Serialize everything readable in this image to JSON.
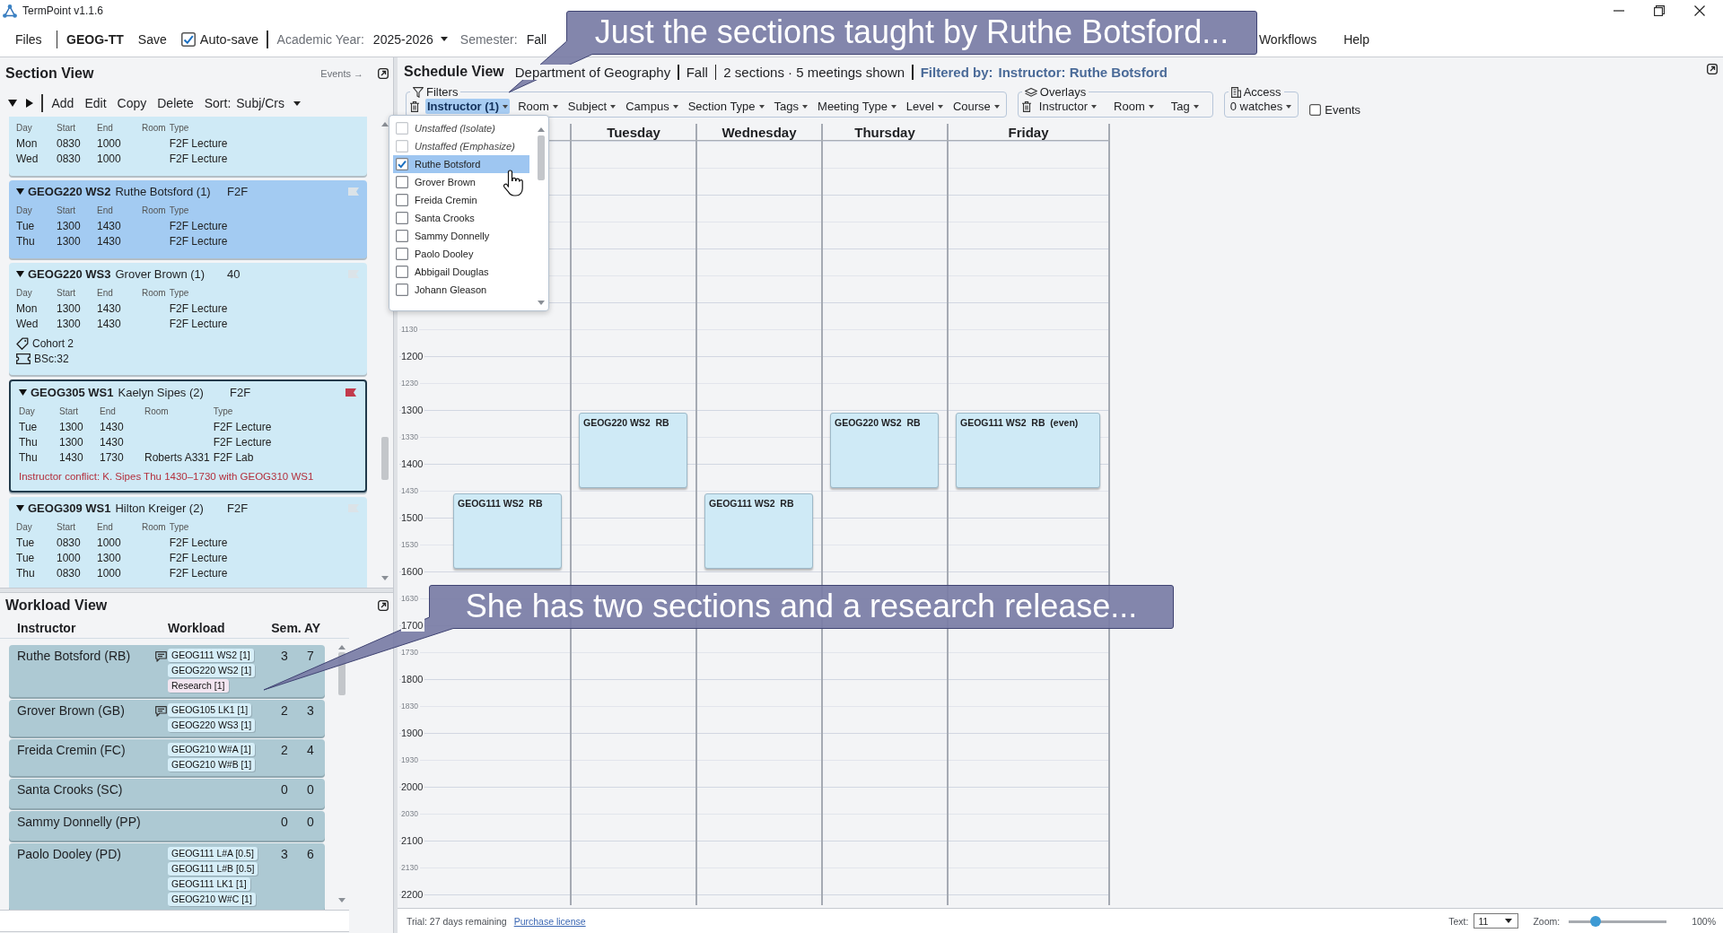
{
  "window": {
    "title": "TermPoint v1.1.6"
  },
  "menu_bar": {
    "files": "Files",
    "project": "GEOG-TT",
    "save": "Save",
    "autosave": {
      "label": "Auto-save",
      "checked": true
    },
    "academic_year": {
      "label": "Academic Year:",
      "value": "2025-2026"
    },
    "semester": {
      "label": "Semester:",
      "value": "Fall"
    },
    "menus": [
      "Workflows",
      "Help"
    ]
  },
  "callouts": [
    {
      "text": "Just the sections taught by Ruthe Botsford..."
    },
    {
      "text": "She has two sections and a research release..."
    }
  ],
  "section_view": {
    "title": "Section View",
    "events_link": "Events →",
    "toolbar": {
      "actions": [
        "Add",
        "Edit",
        "Copy",
        "Delete"
      ],
      "sort_label": "Sort:",
      "sort_value": "Subj/Crs"
    },
    "sections": [
      {
        "selected": false,
        "outlined": false,
        "columns": [
          "Day",
          "Start",
          "End",
          "Room",
          "Type"
        ],
        "meetings": [
          {
            "day": "Mon",
            "start": "0830",
            "end": "1000",
            "type": "F2F Lecture"
          },
          {
            "day": "Wed",
            "start": "0830",
            "end": "1000",
            "type": "F2F Lecture"
          }
        ]
      },
      {
        "expanded": true,
        "code": "GEOG220 WS2",
        "instructor": "Ruthe Botsford (1)",
        "aside": "F2F",
        "flagged": false,
        "selected": true,
        "outlined": false,
        "columns": [
          "Day",
          "Start",
          "End",
          "Room",
          "Type"
        ],
        "meetings": [
          {
            "day": "Tue",
            "start": "1300",
            "end": "1430",
            "type": "F2F Lecture"
          },
          {
            "day": "Thu",
            "start": "1300",
            "end": "1430",
            "type": "F2F Lecture"
          }
        ]
      },
      {
        "expanded": true,
        "code": "GEOG220 WS3",
        "instructor": "Grover Brown (1)",
        "aside": "40",
        "flagged": false,
        "selected": false,
        "outlined": false,
        "columns": [
          "Day",
          "Start",
          "End",
          "Room",
          "Type"
        ],
        "meetings": [
          {
            "day": "Mon",
            "start": "1300",
            "end": "1430",
            "type": "F2F Lecture"
          },
          {
            "day": "Wed",
            "start": "1300",
            "end": "1430",
            "type": "F2F Lecture"
          }
        ],
        "tags": [
          {
            "kind": "tag",
            "label": "Cohort 2"
          },
          {
            "kind": "seats",
            "label": "BSc:32"
          }
        ]
      },
      {
        "expanded": true,
        "code": "GEOG305 WS1",
        "instructor": "Kaelyn Sipes (2)",
        "aside": "F2F",
        "flagged": true,
        "selected": false,
        "outlined": true,
        "columns": [
          "Day",
          "Start",
          "End",
          "Room",
          "Type"
        ],
        "meetings": [
          {
            "day": "Tue",
            "start": "1300",
            "end": "1430",
            "type": "F2F Lecture"
          },
          {
            "day": "Thu",
            "start": "1300",
            "end": "1430",
            "type": "F2F Lecture"
          },
          {
            "day": "Thu",
            "start": "1430",
            "end": "1730",
            "room": "Roberts A331",
            "type": "F2F Lab"
          }
        ],
        "conflict": "Instructor conflict: K. Sipes Thu 1430–1730 with GEOG310 WS1"
      },
      {
        "expanded": true,
        "code": "GEOG309 WS1",
        "instructor": "Hilton Kreiger (2)",
        "aside": "F2F",
        "flagged": false,
        "selected": false,
        "outlined": false,
        "columns": [
          "Day",
          "Start",
          "End",
          "Room",
          "Type"
        ],
        "meetings": [
          {
            "day": "Tue",
            "start": "0830",
            "end": "1000",
            "type": "F2F Lecture"
          },
          {
            "day": "Tue",
            "start": "1000",
            "end": "1300",
            "type": "F2F Lecture"
          },
          {
            "day": "Thu",
            "start": "0830",
            "end": "1000",
            "type": "F2F Lecture"
          }
        ]
      }
    ]
  },
  "workload_view": {
    "title": "Workload View",
    "columns": [
      "Instructor",
      "Workload",
      "Sem.",
      "AY"
    ],
    "rows": [
      {
        "name": "Ruthe Botsford (RB)",
        "note": true,
        "items": [
          {
            "label": "GEOG111 WS2 [1]",
            "kind": "section"
          },
          {
            "label": "GEOG220 WS2 [1]",
            "kind": "section"
          },
          {
            "label": "Research [1]",
            "kind": "release"
          }
        ],
        "sem": "3",
        "ay": "7"
      },
      {
        "name": "Grover Brown (GB)",
        "note": true,
        "items": [
          {
            "label": "GEOG105 LK1 [1]",
            "kind": "section"
          },
          {
            "label": "GEOG220 WS3 [1]",
            "kind": "section"
          }
        ],
        "sem": "2",
        "ay": "3"
      },
      {
        "name": "Freida Cremin (FC)",
        "note": false,
        "items": [
          {
            "label": "GEOG210 W#A [1]",
            "kind": "section"
          },
          {
            "label": "GEOG210 W#B [1]",
            "kind": "section"
          }
        ],
        "sem": "2",
        "ay": "4"
      },
      {
        "name": "Santa Crooks (SC)",
        "note": false,
        "sem": "0",
        "ay": "0"
      },
      {
        "name": "Sammy Donnelly (PP)",
        "note": false,
        "sem": "0",
        "ay": "0"
      },
      {
        "name": "Paolo Dooley (PD)",
        "note": false,
        "items": [
          {
            "label": "GEOG111 L#A [0.5]",
            "kind": "section"
          },
          {
            "label": "GEOG111 L#B [0.5]",
            "kind": "section"
          },
          {
            "label": "GEOG111 LK1 [1]",
            "kind": "section"
          },
          {
            "label": "GEOG210 W#C [1]",
            "kind": "section"
          }
        ],
        "sem": "3",
        "ay": "6"
      }
    ]
  },
  "schedule_view": {
    "title": "Schedule View",
    "department": "Department of Geography",
    "semester": "Fall",
    "summary": "2 sections · 5 meetings shown",
    "filter_label": "Filtered by:",
    "filter_value": "Instructor: Ruthe Botsford",
    "filters": {
      "legend": "Filters",
      "items": [
        {
          "label": "Instructor (1)",
          "selected": true
        },
        {
          "label": "Room",
          "selected": false
        },
        {
          "label": "Subject",
          "selected": false
        },
        {
          "label": "Campus",
          "selected": false
        },
        {
          "label": "Section Type",
          "selected": false
        },
        {
          "label": "Tags",
          "selected": false
        },
        {
          "label": "Meeting Type",
          "selected": false
        },
        {
          "label": "Level",
          "selected": false
        },
        {
          "label": "Course",
          "selected": false
        }
      ]
    },
    "instructor_menu": {
      "options": [
        {
          "label": "Unstaffed (Isolate)",
          "kind": "special",
          "checked": false,
          "selected": false
        },
        {
          "label": "Unstaffed (Emphasize)",
          "kind": "special",
          "checked": false,
          "selected": false
        },
        {
          "label": "Ruthe Botsford",
          "kind": "person",
          "checked": true,
          "selected": true
        },
        {
          "label": "Grover Brown",
          "kind": "person",
          "checked": false,
          "selected": false
        },
        {
          "label": "Freida Cremin",
          "kind": "person",
          "checked": false,
          "selected": false
        },
        {
          "label": "Santa Crooks",
          "kind": "person",
          "checked": false,
          "selected": false
        },
        {
          "label": "Sammy Donnelly",
          "kind": "person",
          "checked": false,
          "selected": false
        },
        {
          "label": "Paolo Dooley",
          "kind": "person",
          "checked": false,
          "selected": false
        },
        {
          "label": "Abbigail Douglas",
          "kind": "person",
          "checked": false,
          "selected": false
        },
        {
          "label": "Johann Gleason",
          "kind": "person",
          "checked": false,
          "selected": false
        }
      ]
    },
    "overlays": {
      "legend": "Overlays",
      "items": [
        "Instructor",
        "Room",
        "Tag"
      ]
    },
    "access": {
      "legend": "Access",
      "value": "0 watches"
    },
    "events_toggle": {
      "label": "Events",
      "checked": false
    },
    "day_headers": [
      "Tuesday",
      "Wednesday",
      "Thursday",
      "Friday"
    ],
    "rows": [
      {
        "label": "1130",
        "kind": "half",
        "cells": [
          {
            "busy": false
          },
          {
            "busy": false
          },
          {
            "busy": false
          },
          {
            "busy": false
          },
          {
            "busy": false
          }
        ]
      },
      {
        "label": "1200",
        "kind": "hour",
        "cells": [
          {
            "busy": false
          },
          {
            "busy": false
          },
          {
            "busy": false
          },
          {
            "busy": false
          },
          {
            "busy": false
          }
        ]
      },
      {
        "label": "1230",
        "kind": "half",
        "cells": [
          {
            "busy": false
          },
          {
            "busy": false
          },
          {
            "busy": false
          },
          {
            "busy": false
          },
          {
            "busy": false
          }
        ]
      },
      {
        "label": "1300",
        "kind": "hour",
        "cells": [
          {
            "busy": false
          },
          {
            "busy": true,
            "event": "GEOG220 WS2  RB"
          },
          {
            "busy": false
          },
          {
            "busy": true,
            "event": "GEOG220 WS2  RB"
          },
          {
            "busy": true,
            "event": "GEOG111 WS2  RB  (even)"
          }
        ]
      },
      {
        "label": "1330",
        "kind": "half",
        "cells": [
          {
            "busy": false
          },
          {
            "busy": true
          },
          {
            "busy": false
          },
          {
            "busy": true
          },
          {
            "busy": true
          }
        ]
      },
      {
        "label": "1400",
        "kind": "hour",
        "cells": [
          {
            "busy": false
          },
          {
            "busy": true
          },
          {
            "busy": false
          },
          {
            "busy": true
          },
          {
            "busy": true
          }
        ]
      },
      {
        "label": "1430",
        "kind": "half",
        "cells": [
          {
            "busy": true,
            "event": "GEOG111 WS2  RB"
          },
          {
            "busy": false
          },
          {
            "busy": true,
            "event": "GEOG111 WS2  RB"
          },
          {
            "busy": false
          },
          {
            "busy": false
          }
        ]
      },
      {
        "label": "1500",
        "kind": "hour",
        "cells": [
          {
            "busy": true
          },
          {
            "busy": false
          },
          {
            "busy": true
          },
          {
            "busy": false
          },
          {
            "busy": false
          }
        ]
      },
      {
        "label": "1530",
        "kind": "half",
        "cells": [
          {
            "busy": true
          },
          {
            "busy": false
          },
          {
            "busy": true
          },
          {
            "busy": false
          },
          {
            "busy": false
          }
        ]
      },
      {
        "label": "1600",
        "kind": "hour",
        "cells": [
          {
            "busy": false
          },
          {
            "busy": false
          },
          {
            "busy": false
          },
          {
            "busy": false
          },
          {
            "busy": false
          }
        ]
      },
      {
        "label": "1630",
        "kind": "half",
        "cells": [
          {
            "busy": false
          },
          {
            "busy": false
          },
          {
            "busy": false
          },
          {
            "busy": false
          },
          {
            "busy": false
          }
        ]
      },
      {
        "label": "1700",
        "kind": "hour",
        "cells": [
          {
            "busy": false
          },
          {
            "busy": false
          },
          {
            "busy": false
          },
          {
            "busy": false
          },
          {
            "busy": false
          }
        ]
      },
      {
        "label": "1730",
        "kind": "half",
        "cells": [
          {
            "busy": false
          },
          {
            "busy": false
          },
          {
            "busy": false
          },
          {
            "busy": false
          },
          {
            "busy": false
          }
        ]
      },
      {
        "label": "1800",
        "kind": "hour",
        "cells": [
          {
            "busy": false
          },
          {
            "busy": false
          },
          {
            "busy": false
          },
          {
            "busy": false
          },
          {
            "busy": false
          }
        ]
      },
      {
        "label": "1830",
        "kind": "half",
        "cells": [
          {
            "busy": false
          },
          {
            "busy": false
          },
          {
            "busy": false
          },
          {
            "busy": false
          },
          {
            "busy": false
          }
        ]
      },
      {
        "label": "1900",
        "kind": "hour",
        "cells": [
          {
            "busy": false
          },
          {
            "busy": false
          },
          {
            "busy": false
          },
          {
            "busy": false
          },
          {
            "busy": false
          }
        ]
      },
      {
        "label": "1930",
        "kind": "half",
        "cells": [
          {
            "busy": false
          },
          {
            "busy": false
          },
          {
            "busy": false
          },
          {
            "busy": false
          },
          {
            "busy": false
          }
        ]
      },
      {
        "label": "2000",
        "kind": "hour",
        "cells": [
          {
            "busy": false
          },
          {
            "busy": false
          },
          {
            "busy": false
          },
          {
            "busy": false
          },
          {
            "busy": false
          }
        ]
      },
      {
        "label": "2030",
        "kind": "half",
        "cells": [
          {
            "busy": false
          },
          {
            "busy": false
          },
          {
            "busy": false
          },
          {
            "busy": false
          },
          {
            "busy": false
          }
        ]
      },
      {
        "label": "2100",
        "kind": "hour",
        "cells": [
          {
            "busy": false
          },
          {
            "busy": false
          },
          {
            "busy": false
          },
          {
            "busy": false
          },
          {
            "busy": false
          }
        ]
      },
      {
        "label": "2130",
        "kind": "half",
        "cells": [
          {
            "busy": false
          },
          {
            "busy": false
          },
          {
            "busy": false
          },
          {
            "busy": false
          },
          {
            "busy": false
          }
        ]
      },
      {
        "label": "2200",
        "kind": "hour",
        "cells": [
          {
            "busy": false
          },
          {
            "busy": false
          },
          {
            "busy": false
          },
          {
            "busy": false
          },
          {
            "busy": false
          }
        ]
      }
    ]
  },
  "status_bar": {
    "trial": "Trial: 27 days remaining",
    "link": "Purchase license",
    "text_size": {
      "label": "Text:",
      "value": "11"
    },
    "zoom": {
      "label": "Zoom:",
      "level": 0.27,
      "reading": "100%"
    }
  }
}
